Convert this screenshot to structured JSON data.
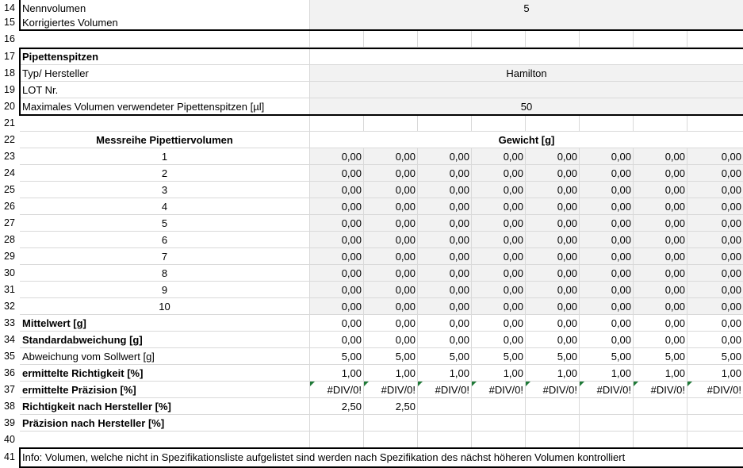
{
  "rows": {
    "r14": {
      "num": "14",
      "label": "Nennvolumen",
      "value": "5"
    },
    "r15": {
      "num": "15",
      "label": "Korrigiertes Volumen"
    },
    "r16": {
      "num": "16"
    },
    "r17": {
      "num": "17",
      "label": "Pipettenspitzen"
    },
    "r18": {
      "num": "18",
      "label": "Typ/ Hersteller",
      "value": "Hamilton"
    },
    "r19": {
      "num": "19",
      "label": "LOT Nr."
    },
    "r20": {
      "num": "20",
      "label": "Maximales Volumen verwendeter Pipettenspitzen [µl]",
      "value": "50"
    },
    "r21": {
      "num": "21"
    },
    "r22": {
      "num": "22",
      "label": "Messreihe Pipettiervolumen",
      "value": "Gewicht [g]"
    },
    "r33": {
      "num": "33",
      "label": "Mittelwert [g]"
    },
    "r34": {
      "num": "34",
      "label": "Standardabweichung [g]"
    },
    "r35": {
      "num": "35",
      "label": "Abweichung vom Sollwert [g]"
    },
    "r36": {
      "num": "36",
      "label": "ermittelte Richtigkeit [%]"
    },
    "r37": {
      "num": "37",
      "label": "ermittelte Präzision [%]"
    },
    "r38": {
      "num": "38",
      "label": "Richtigkeit nach Hersteller [%]"
    },
    "r39": {
      "num": "39",
      "label": "Präzision nach Hersteller [%]"
    },
    "r40": {
      "num": "40"
    },
    "r41": {
      "num": "41",
      "label": "Info: Volumen, welche nicht in Spezifikationsliste aufgelistet sind werden nach Spezifikation des nächst höheren Volumen kontrolliert"
    }
  },
  "measurements": [
    {
      "num": "23",
      "series": "1",
      "values": [
        "0,00",
        "0,00",
        "0,00",
        "0,00",
        "0,00",
        "0,00",
        "0,00",
        "0,00"
      ]
    },
    {
      "num": "24",
      "series": "2",
      "values": [
        "0,00",
        "0,00",
        "0,00",
        "0,00",
        "0,00",
        "0,00",
        "0,00",
        "0,00"
      ]
    },
    {
      "num": "25",
      "series": "3",
      "values": [
        "0,00",
        "0,00",
        "0,00",
        "0,00",
        "0,00",
        "0,00",
        "0,00",
        "0,00"
      ]
    },
    {
      "num": "26",
      "series": "4",
      "values": [
        "0,00",
        "0,00",
        "0,00",
        "0,00",
        "0,00",
        "0,00",
        "0,00",
        "0,00"
      ]
    },
    {
      "num": "27",
      "series": "5",
      "values": [
        "0,00",
        "0,00",
        "0,00",
        "0,00",
        "0,00",
        "0,00",
        "0,00",
        "0,00"
      ]
    },
    {
      "num": "28",
      "series": "6",
      "values": [
        "0,00",
        "0,00",
        "0,00",
        "0,00",
        "0,00",
        "0,00",
        "0,00",
        "0,00"
      ]
    },
    {
      "num": "29",
      "series": "7",
      "values": [
        "0,00",
        "0,00",
        "0,00",
        "0,00",
        "0,00",
        "0,00",
        "0,00",
        "0,00"
      ]
    },
    {
      "num": "30",
      "series": "8",
      "values": [
        "0,00",
        "0,00",
        "0,00",
        "0,00",
        "0,00",
        "0,00",
        "0,00",
        "0,00"
      ]
    },
    {
      "num": "31",
      "series": "9",
      "values": [
        "0,00",
        "0,00",
        "0,00",
        "0,00",
        "0,00",
        "0,00",
        "0,00",
        "0,00"
      ]
    },
    {
      "num": "32",
      "series": "10",
      "values": [
        "0,00",
        "0,00",
        "0,00",
        "0,00",
        "0,00",
        "0,00",
        "0,00",
        "0,00"
      ]
    }
  ],
  "stats": {
    "mittelwert": [
      "0,00",
      "0,00",
      "0,00",
      "0,00",
      "0,00",
      "0,00",
      "0,00",
      "0,00"
    ],
    "standardabweichung": [
      "0,00",
      "0,00",
      "0,00",
      "0,00",
      "0,00",
      "0,00",
      "0,00",
      "0,00"
    ],
    "abweichung": [
      "5,00",
      "5,00",
      "5,00",
      "5,00",
      "5,00",
      "5,00",
      "5,00",
      "5,00"
    ],
    "richtigkeit": [
      "1,00",
      "1,00",
      "1,00",
      "1,00",
      "1,00",
      "1,00",
      "1,00",
      "1,00"
    ],
    "praezision": [
      "#DIV/0!",
      "#DIV/0!",
      "#DIV/0!",
      "#DIV/0!",
      "#DIV/0!",
      "#DIV/0!",
      "#DIV/0!",
      "#DIV/0!"
    ],
    "richtigkeit_hersteller": [
      "2,50",
      "2,50"
    ]
  },
  "colors": {
    "input_fill": "#f2f2f2",
    "gridline": "#d9d9d9",
    "error_marker": "#1f7a38"
  }
}
